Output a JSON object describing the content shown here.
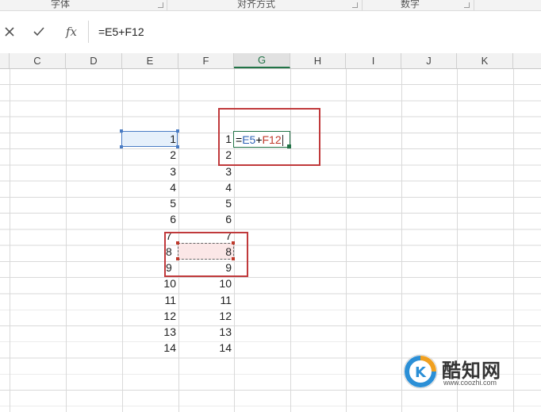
{
  "ribbon": {
    "groups": [
      {
        "name": "font",
        "label": "字体"
      },
      {
        "name": "alignment",
        "label": "对齐方式"
      },
      {
        "name": "number",
        "label": "数字"
      }
    ]
  },
  "formula_bar": {
    "cancel_icon": "close-icon",
    "enter_icon": "check-icon",
    "function_label": "fx",
    "formula": "=E5+F12"
  },
  "columns": [
    "C",
    "D",
    "E",
    "F",
    "G",
    "H",
    "I",
    "J",
    "K"
  ],
  "active_column": "G",
  "cells": {
    "column_E": [
      "1",
      "2",
      "3",
      "4",
      "5",
      "6",
      "7",
      "8",
      "9",
      "10",
      "11",
      "12",
      "13",
      "14"
    ],
    "column_F": [
      "1",
      "2",
      "3",
      "4",
      "5",
      "6",
      "7",
      "8",
      "9",
      "10",
      "11",
      "12",
      "13",
      "14"
    ]
  },
  "edit_cell": {
    "prefix": "=",
    "ref1": "E5",
    "operator": "+",
    "ref2": "F12"
  },
  "colors": {
    "ref1": "#2e62b5",
    "ref2": "#c0392b",
    "highlight_box": "#c0393b",
    "selection_green": "#217346"
  },
  "watermark": {
    "title": "酷知网",
    "url": "www.coozhi.com"
  }
}
